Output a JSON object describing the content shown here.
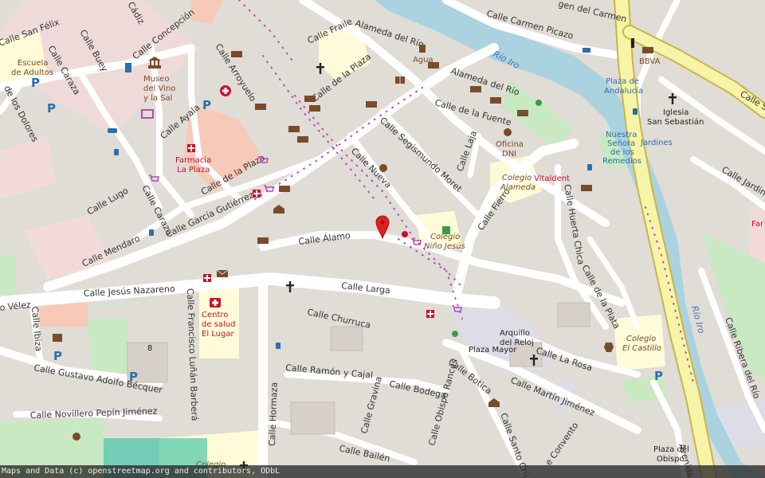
{
  "streets": {
    "calle_san_felix": "Calle San Félix",
    "calle_concepcion": "Calle Concepción",
    "calle_buey": "Calle Buey",
    "calle_caraza_top": "Calle Caraza",
    "calle_caraza_mid": "Calle Caraza",
    "calle_de_los_dolores": "de los Dolores",
    "calle_cadiz": "Cádiz",
    "calle_fraile": "Calle Fraile",
    "calle_arroyuelo": "Calle Arroyuelo",
    "calle_de_la_plaza_top": "Calle de la Plaza",
    "calle_de_la_plaza_left": "Calle de la Plaza",
    "calle_ayala": "Calle Ayala",
    "alameda_del_rio_top": "Alameda del Río",
    "alameda_del_rio_mid": "Alameda del Río",
    "calle_del_carmen": "gen del Carmen",
    "calle_carmen_picazo": "Calle Carmen Picazo",
    "calle_de_la_fuente": "Calle de la Fuente",
    "calle_segismundo": "Calle Segismundo Moret",
    "calle_laja": "Calle Laja",
    "calle_nueva": "Calle Nueva",
    "calle_lugo": "Calle Lugo",
    "calle_garcia_gutierrez": "Calle García Gutiérrez",
    "calle_mendaro": "Calle Mendaro",
    "calle_alamo": "Calle Álamo",
    "calle_fierro": "Calle Fierro",
    "calle_huerta_chica": "Calle Huerta Chica",
    "calle_de_la_plata": "Calle de la Plata",
    "calle_jesus_nazareno": "Calle Jesús Nazareno",
    "calle_velez": "o Vélez",
    "calle_larga": "Calle Larga",
    "calle_ibiza": "Calle Ibiza",
    "calle_francisco": "Calle Francisco Luñán Barberá",
    "calle_churruca": "Calle Churruca",
    "calle_gustavo": "Calle Gustavo Adolfo Bécquer",
    "calle_novillero": "Calle Novillero Pepín Jiménez",
    "calle_hormaza": "Calle Hormaza",
    "calle_ramon": "Calle Ramón y Cajal",
    "calle_gravina": "Calle Gravina",
    "calle_bodega": "Calle Bodega",
    "calle_obispo": "Calle Obispo Rancés",
    "calle_botica": "Calle Botica",
    "calle_santo": "Calle Santo Crist",
    "calle_la_rosa": "Calle La Rosa",
    "calle_martin": "Calle Martín Jiménez",
    "calle_convento": "e Convento",
    "calle_bailen": "Calle Bailén",
    "calle_jardines": "Calle Jardines",
    "calle_ribera": "Calle Ribera del Río",
    "calle_s_right": "Calle S",
    "avenida": "Avenida"
  },
  "pois": {
    "escuela": [
      "Escuela",
      "de Adultos"
    ],
    "museo": [
      "Museo",
      "del Vino",
      "y la Sal"
    ],
    "farmacia": [
      "Farmacia",
      "La Plaza"
    ],
    "agua": "Agua",
    "oficina": [
      "Oficina",
      "DNI"
    ],
    "colegio_alameda": [
      "Colegio",
      "Alameda"
    ],
    "vitaldent": "Vitaldent",
    "colegio_nino": [
      "Colegio",
      "Niño Jesús"
    ],
    "centro_salud": [
      "Centro",
      "de salud",
      "El Lugar"
    ],
    "arquillo": [
      "Arquillo",
      "del Reloj"
    ],
    "plaza_mayor": "Plaza Mayor",
    "colegio_castillo": [
      "Colegio",
      "El Castillo"
    ],
    "plaza_andalucia": [
      "Plaza de",
      "Andalucía"
    ],
    "bbva": "BBVA",
    "iglesia": [
      "Iglesia",
      "San Sebastián"
    ],
    "nuestra_senora": [
      "Nuestra",
      "Señora",
      "de los",
      "Remedios"
    ],
    "jardines": "Jardines",
    "plaza_obispo": [
      "Plaza del",
      "Obispo"
    ],
    "colegio_bottom": "Colegio",
    "far_right": "Far",
    "number_8": "8"
  },
  "water": {
    "rio_top": "Río Iro",
    "rio_right": "Río Iro"
  },
  "marker": {
    "name": "location-pin",
    "color": "#e0201a"
  },
  "attribution": "Maps and Data (c) openstreetmap.org and contributors, ODbL",
  "colors": {
    "background": "#e0dcd6",
    "road": "#ffffff",
    "water": "#aad3df",
    "park": "#c8e9c1",
    "pedestrian": "#dddde8",
    "residential_pink": "#f2dadb",
    "school": "#fffbd8",
    "highway": "#f7f4a8",
    "highway_border": "#c9b54a"
  }
}
